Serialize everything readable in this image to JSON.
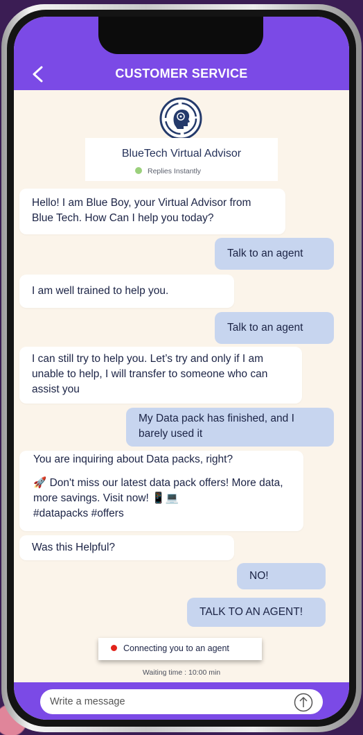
{
  "header": {
    "title": "CUSTOMER SERVICE",
    "back_icon": "chevron-left-icon",
    "color": "#7b4ae6"
  },
  "advisor": {
    "logo_icon": "brain-head-icon",
    "name": "BlueTech Virtual Advisor",
    "status": "Replies Instantly",
    "status_color": "#9bd07c"
  },
  "messages": [
    {
      "from": "bot",
      "text": "Hello! I am Blue Boy, your Virtual Advisor from Blue Tech. How Can I help you today?"
    },
    {
      "from": "user",
      "text": "Talk to an agent"
    },
    {
      "from": "bot",
      "text": "I am well trained to help you."
    },
    {
      "from": "user",
      "text": "Talk to an agent"
    },
    {
      "from": "bot",
      "text": "I can still try to help you. Let’s try and only if I am unable to help, I will transfer to someone who can assist you"
    },
    {
      "from": "user",
      "text": "My Data pack has finished, and I barely used it"
    },
    {
      "from": "bot",
      "line1": "You are inquiring about Data packs, right?",
      "line2": "🚀 Don't miss our latest data pack offers! More data, more savings. Visit now! 📱💻",
      "line3": "#datapacks #offers"
    },
    {
      "from": "bot",
      "text": "Was this Helpful?"
    },
    {
      "from": "user",
      "text": "NO!"
    },
    {
      "from": "user",
      "text": "TALK TO AN AGENT!"
    }
  ],
  "status": {
    "connecting": "Connecting you to an agent",
    "connecting_color": "#e2231a",
    "waiting": "Waiting time : 10:00 min"
  },
  "composer": {
    "placeholder": "Write a message",
    "send_icon": "arrow-up-circle-icon"
  }
}
